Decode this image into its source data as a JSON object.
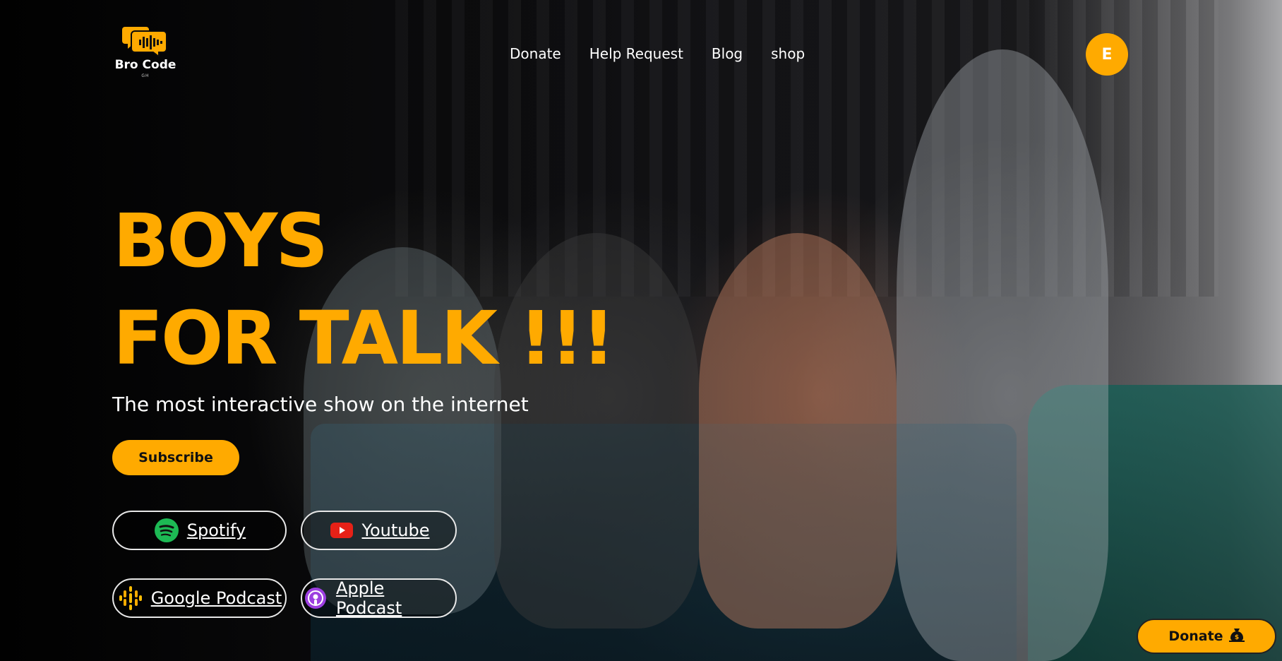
{
  "brand": {
    "name": "Bro Code",
    "sub": "GH",
    "accent": "#ffaa00"
  },
  "nav": {
    "items": [
      {
        "label": "Donate"
      },
      {
        "label": "Help Request"
      },
      {
        "label": "Blog"
      },
      {
        "label": "shop"
      }
    ]
  },
  "user": {
    "avatar_initial": "E"
  },
  "hero": {
    "headline_line1": "BOYS",
    "headline_line2": "FOR TALK !!!",
    "tagline": "The most interactive show on the internet",
    "subscribe_label": "Subscribe"
  },
  "platforms": [
    {
      "label": "Spotify",
      "icon": "spotify-icon",
      "color": "#1db954"
    },
    {
      "label": "Youtube",
      "icon": "youtube-icon",
      "color": "#e62117"
    },
    {
      "label": "Google Podcast",
      "icon": "google-podcast-icon",
      "color": "#fbbc04"
    },
    {
      "label": "Apple Podcast",
      "icon": "apple-podcast-icon",
      "color": "#9c3fe0"
    }
  ],
  "floating": {
    "donate_label": "Donate",
    "icon": "money-bag-icon"
  }
}
